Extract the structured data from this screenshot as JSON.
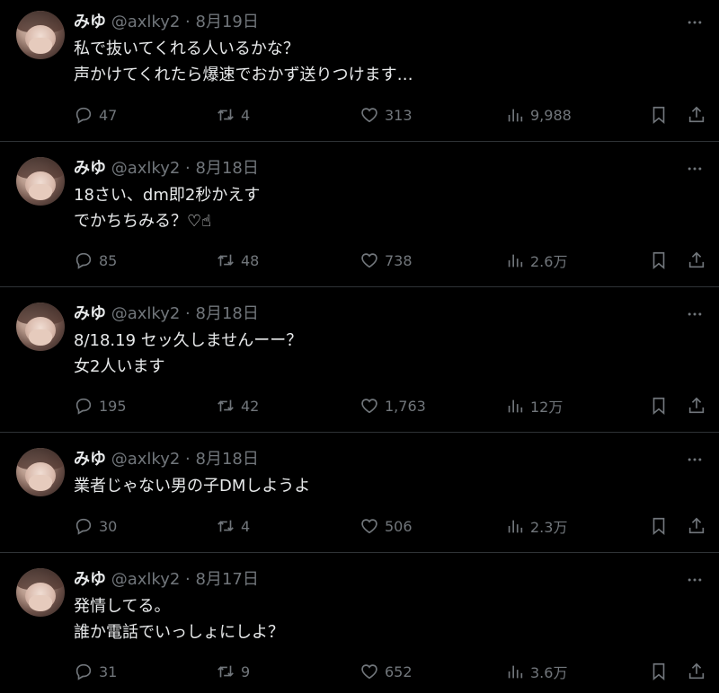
{
  "tweets": [
    {
      "name": "みゆ",
      "handle": "@axlky2",
      "date": "8月19日",
      "text": "私で抜いてくれる人いるかな？\n声かけてくれたら爆速でおかず送りつけます…",
      "replies": "47",
      "retweets": "4",
      "likes": "313",
      "views": "9,988"
    },
    {
      "name": "みゆ",
      "handle": "@axlky2",
      "date": "8月18日",
      "text": "18さい、dm即2秒かえす\nでかちちみる？♡☝",
      "replies": "85",
      "retweets": "48",
      "likes": "738",
      "views": "2.6万"
    },
    {
      "name": "みゆ",
      "handle": "@axlky2",
      "date": "8月18日",
      "text": "8/18.19 セッ久しませんーー？\n女2人います",
      "replies": "195",
      "retweets": "42",
      "likes": "1,763",
      "views": "12万"
    },
    {
      "name": "みゆ",
      "handle": "@axlky2",
      "date": "8月18日",
      "text": "業者じゃない男の子DMしようよ",
      "replies": "30",
      "retweets": "4",
      "likes": "506",
      "views": "2.3万"
    },
    {
      "name": "みゆ",
      "handle": "@axlky2",
      "date": "8月17日",
      "text": "発情してる。\n誰か電話でいっしょにしよ？",
      "replies": "31",
      "retweets": "9",
      "likes": "652",
      "views": "3.6万"
    }
  ],
  "header_separator": "·",
  "icons": {
    "more": "more-horizontal-icon",
    "reply": "reply-icon",
    "retweet": "retweet-icon",
    "like": "heart-icon",
    "views": "views-chart-icon",
    "bookmark": "bookmark-icon",
    "share": "share-icon"
  },
  "colors": {
    "background": "#000000",
    "text": "#e7e9ea",
    "muted": "#71767b",
    "divider": "#2f3336"
  }
}
